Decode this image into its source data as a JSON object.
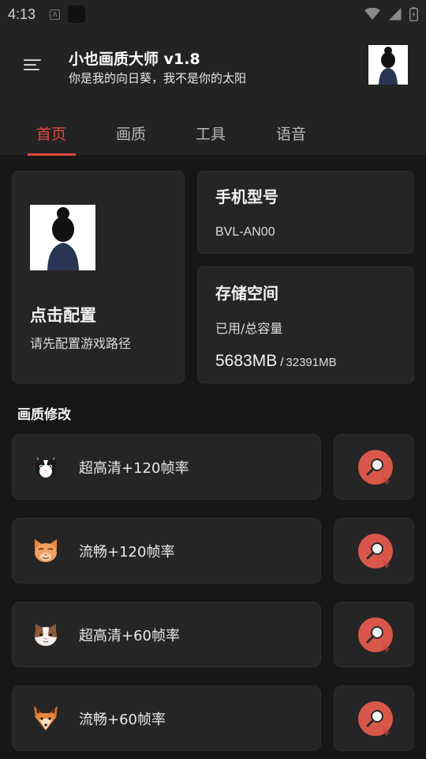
{
  "status_bar": {
    "time": "4:13",
    "a_icon": "A"
  },
  "header": {
    "title": "小也画质大师 v1.8",
    "subtitle": "你是我的向日葵，我不是你的太阳"
  },
  "tabs": [
    {
      "label": "首页",
      "active": true
    },
    {
      "label": "画质",
      "active": false
    },
    {
      "label": "工具",
      "active": false
    },
    {
      "label": "语音",
      "active": false
    }
  ],
  "config_card": {
    "title": "点击配置",
    "subtitle": "请先配置游戏路径"
  },
  "model_card": {
    "title": "手机型号",
    "value": "BVL-AN00"
  },
  "storage_card": {
    "title": "存储空间",
    "label": "已用/总容量",
    "used": "5683MB",
    "separator": "/",
    "total": "32391MB"
  },
  "quality_section": {
    "title": "画质修改",
    "options": [
      {
        "label": "超高清+120帧率",
        "icon": "black-white-cat-icon"
      },
      {
        "label": "流畅+120帧率",
        "icon": "orange-cat-icon"
      },
      {
        "label": "超高清+60帧率",
        "icon": "brown-white-cat-icon"
      },
      {
        "label": "流畅+60帧率",
        "icon": "fox-icon"
      }
    ],
    "action_icon": "magnifier-icon"
  },
  "colors": {
    "accent": "#e0493b",
    "background": "#171717",
    "card": "#252525",
    "action_button": "#d9574a"
  }
}
